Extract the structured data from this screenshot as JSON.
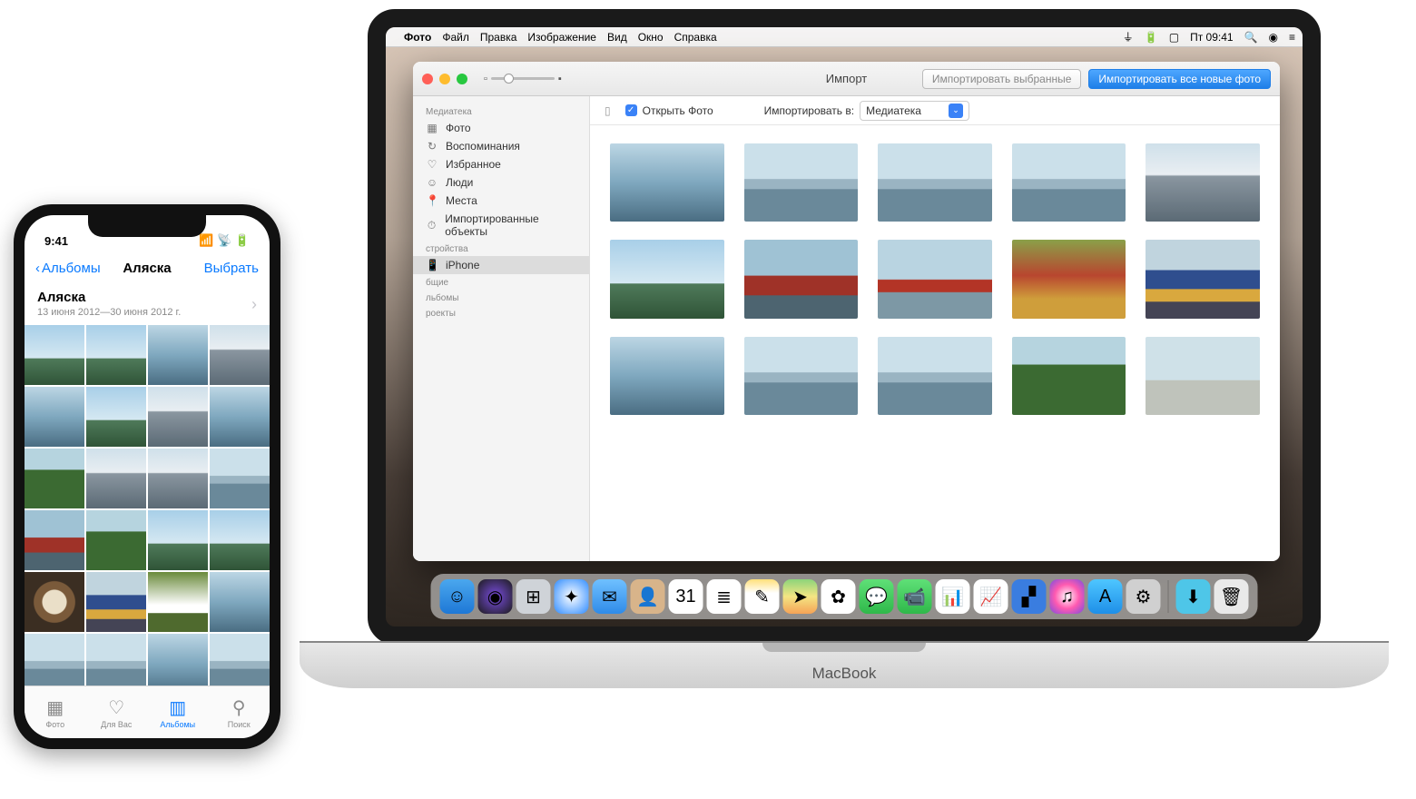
{
  "macbook": {
    "label": "MacBook"
  },
  "menubar": {
    "app": "Фото",
    "items": [
      "Файл",
      "Правка",
      "Изображение",
      "Вид",
      "Окно",
      "Справка"
    ],
    "clock": "Пт 09:41"
  },
  "photos_window": {
    "title": "Импорт",
    "import_selected": "Импортировать выбранные",
    "import_all": "Импортировать все новые фото",
    "open_photos_label": "Открыть Фото",
    "import_to_label": "Импортировать в:",
    "import_to_value": "Медиатека",
    "sidebar": {
      "library_header": "Медиатека",
      "library": [
        {
          "icon": "▦",
          "label": "Фото"
        },
        {
          "icon": "↻",
          "label": "Воспоминания"
        },
        {
          "icon": "♡",
          "label": "Избранное"
        },
        {
          "icon": "☺",
          "label": "Люди"
        },
        {
          "icon": "📍",
          "label": "Места"
        },
        {
          "icon": "⏱",
          "label": "Импортированные объекты"
        }
      ],
      "devices_header": "стройства",
      "devices": [
        {
          "icon": "📱",
          "label": "iPhone"
        }
      ],
      "shared_header": "бщие",
      "albums_header": "льбомы",
      "projects_header": "роекты"
    }
  },
  "iphone": {
    "time": "9:41",
    "nav_back": "Альбомы",
    "nav_title": "Аляска",
    "nav_action": "Выбрать",
    "album_title": "Аляска",
    "album_subtitle": "13 июня 2012—30 июня 2012 г.",
    "tabs": [
      {
        "icon": "▦",
        "label": "Фото"
      },
      {
        "icon": "♡",
        "label": "Для Вас"
      },
      {
        "icon": "▥",
        "label": "Альбомы"
      },
      {
        "icon": "⚲",
        "label": "Поиск"
      }
    ],
    "active_tab": 2
  },
  "dock_icons": [
    {
      "name": "finder",
      "bg": "linear-gradient(#4aa7ee,#1e78d6)",
      "glyph": "☺"
    },
    {
      "name": "siri",
      "bg": "radial-gradient(circle,#7a4de0,#1b1b1b)",
      "glyph": "◉"
    },
    {
      "name": "launchpad",
      "bg": "#cfd3d8",
      "glyph": "⊞"
    },
    {
      "name": "safari",
      "bg": "radial-gradient(circle,#fff,#2e8bff)",
      "glyph": "✦"
    },
    {
      "name": "mail",
      "bg": "linear-gradient(#6fc0ff,#2f8be8)",
      "glyph": "✉"
    },
    {
      "name": "contacts",
      "bg": "#d8b48a",
      "glyph": "👤"
    },
    {
      "name": "calendar",
      "bg": "#fff",
      "glyph": "31"
    },
    {
      "name": "reminders",
      "bg": "#fff",
      "glyph": "≣"
    },
    {
      "name": "notes",
      "bg": "linear-gradient(#ffe07a,#fff 40%)",
      "glyph": "✎"
    },
    {
      "name": "maps",
      "bg": "linear-gradient(#8cd47a,#f4e583 50%,#f5a356)",
      "glyph": "➤"
    },
    {
      "name": "photos",
      "bg": "#fff",
      "glyph": "✿"
    },
    {
      "name": "messages",
      "bg": "linear-gradient(#5fe077,#2fb84a)",
      "glyph": "💬"
    },
    {
      "name": "facetime",
      "bg": "linear-gradient(#5fe077,#2fb84a)",
      "glyph": "📹"
    },
    {
      "name": "pages",
      "bg": "#fff",
      "glyph": "📊"
    },
    {
      "name": "numbers",
      "bg": "#fff",
      "glyph": "📈"
    },
    {
      "name": "keynote",
      "bg": "#3a7de0",
      "glyph": "▞"
    },
    {
      "name": "itunes",
      "bg": "radial-gradient(circle,#fff,#ff5ab0,#7a4de0)",
      "glyph": "♫"
    },
    {
      "name": "appstore",
      "bg": "linear-gradient(#4ec6ff,#1e8fe8)",
      "glyph": "A"
    },
    {
      "name": "settings",
      "bg": "#d0d0d0",
      "glyph": "⚙"
    }
  ],
  "dock_right": [
    {
      "name": "downloads",
      "bg": "#4ec6e8",
      "glyph": "⬇"
    },
    {
      "name": "trash",
      "bg": "#e9e9e9",
      "glyph": "🗑"
    }
  ],
  "mac_thumbs": [
    "water",
    "boats",
    "boats",
    "boats",
    "mtn",
    "sky",
    "redhouse",
    "plane",
    "flowers",
    "train",
    "water",
    "boats",
    "boats",
    "green",
    "beach"
  ],
  "ios_thumbs": [
    "sky",
    "sky",
    "water",
    "mtn",
    "water",
    "sky",
    "mtn",
    "water",
    "green",
    "mtn",
    "mtn",
    "boats",
    "redhouse",
    "green",
    "sky",
    "sky",
    "wheel",
    "train",
    "tent",
    "water",
    "boats",
    "boats",
    "water",
    "boats"
  ]
}
